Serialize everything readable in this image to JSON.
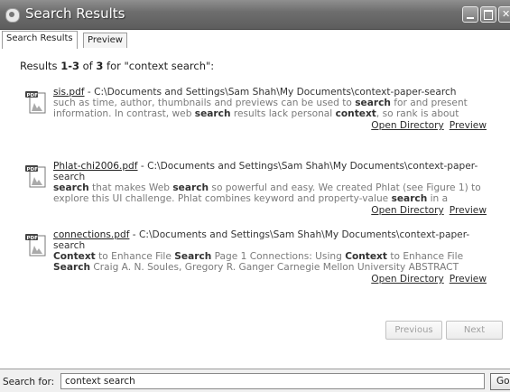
{
  "window": {
    "title": "Search Results"
  },
  "tabs": [
    {
      "label": "Search Results",
      "active": true
    },
    {
      "label": "Preview",
      "active": false
    }
  ],
  "summary": {
    "prefix": "Results ",
    "range": "1-3",
    "of_text": " of ",
    "total": "3",
    "for_text": " for \"context search\":"
  },
  "results": [
    {
      "file": "sis.pdf",
      "path": " - C:\\Documents and Settings\\Sam Shah\\My Documents\\context-paper-search",
      "snippet_parts": [
        {
          "t": "such as time, author, thumbnails and previews can be used to ",
          "b": false
        },
        {
          "t": "search",
          "b": true
        },
        {
          "t": " for and present information. In contrast, web ",
          "b": false
        },
        {
          "t": "search",
          "b": true
        },
        {
          "t": " results lack personal ",
          "b": false
        },
        {
          "t": "context",
          "b": true
        },
        {
          "t": ", so rank is about",
          "b": false
        }
      ],
      "open_label": "Open Directory",
      "preview_label": "Preview"
    },
    {
      "file": "Phlat-chi2006.pdf",
      "path": " - C:\\Documents and Settings\\Sam Shah\\My Documents\\context-paper-search",
      "snippet_parts": [
        {
          "t": "search",
          "b": true
        },
        {
          "t": " that makes Web ",
          "b": false
        },
        {
          "t": "search",
          "b": true
        },
        {
          "t": " so powerful and easy. We created Phlat (see Figure 1) to explore this UI challenge. Phlat combines keyword and property-value ",
          "b": false
        },
        {
          "t": "search",
          "b": true
        },
        {
          "t": " in a",
          "b": false
        }
      ],
      "open_label": "Open Directory",
      "preview_label": "Preview"
    },
    {
      "file": "connections.pdf",
      "path": " - C:\\Documents and Settings\\Sam Shah\\My Documents\\context-paper-search",
      "snippet_parts": [
        {
          "t": "Context",
          "b": true
        },
        {
          "t": " to Enhance File ",
          "b": false
        },
        {
          "t": "Search",
          "b": true
        },
        {
          "t": " Page 1 Connections: Using ",
          "b": false
        },
        {
          "t": "Context",
          "b": true
        },
        {
          "t": " to Enhance File ",
          "b": false
        },
        {
          "t": "Search",
          "b": true
        },
        {
          "t": " Craig A. N. Soules, Gregory R. Ganger Carnegie Mellon University ABSTRACT",
          "b": false
        }
      ],
      "open_label": "Open Directory",
      "preview_label": "Preview"
    }
  ],
  "pager": {
    "previous_label": "Previous",
    "next_label": "Next"
  },
  "searchbar": {
    "label": "Search for:",
    "value": "context search",
    "go_label": "Go"
  },
  "icons": {
    "result_icon": "pdf-file-icon",
    "app_icon": "search-app-icon"
  }
}
